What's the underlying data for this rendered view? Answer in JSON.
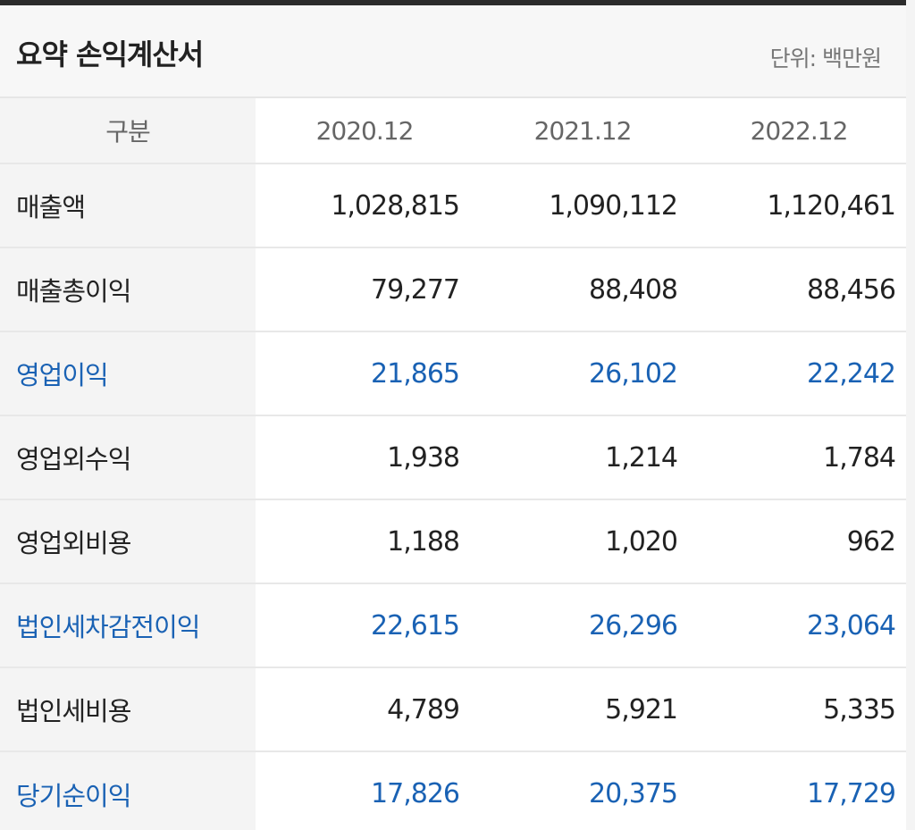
{
  "title": "요약 손익계산서",
  "unit": "단위: 백만원",
  "columns": {
    "category": "구분",
    "periods": [
      "2020.12",
      "2021.12",
      "2022.12"
    ]
  },
  "rows": [
    {
      "label": "매출액",
      "values": [
        "1,028,815",
        "1,090,112",
        "1,120,461"
      ],
      "highlight": false
    },
    {
      "label": "매출총이익",
      "values": [
        "79,277",
        "88,408",
        "88,456"
      ],
      "highlight": false
    },
    {
      "label": "영업이익",
      "values": [
        "21,865",
        "26,102",
        "22,242"
      ],
      "highlight": true
    },
    {
      "label": "영업외수익",
      "values": [
        "1,938",
        "1,214",
        "1,784"
      ],
      "highlight": false
    },
    {
      "label": "영업외비용",
      "values": [
        "1,188",
        "1,020",
        "962"
      ],
      "highlight": false
    },
    {
      "label": "법인세차감전이익",
      "values": [
        "22,615",
        "26,296",
        "23,064"
      ],
      "highlight": true
    },
    {
      "label": "법인세비용",
      "values": [
        "4,789",
        "5,921",
        "5,335"
      ],
      "highlight": false
    },
    {
      "label": "당기순이익",
      "values": [
        "17,826",
        "20,375",
        "17,729"
      ],
      "highlight": true
    }
  ],
  "colors": {
    "highlight": "#1a62b4",
    "text": "#222222",
    "header_text": "#666666",
    "label_bg": "#f4f4f4"
  }
}
